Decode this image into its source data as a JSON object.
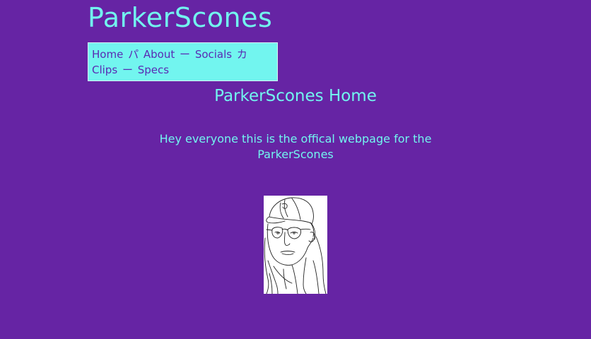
{
  "site": {
    "title": "ParkerScones"
  },
  "nav": {
    "items": [
      {
        "label": "Home",
        "sep": "パ"
      },
      {
        "label": "About",
        "sep": "ー"
      },
      {
        "label": "Socials",
        "sep": "カ"
      },
      {
        "label": "Clips",
        "sep": "ー"
      },
      {
        "label": "Specs",
        "sep": ""
      }
    ]
  },
  "main": {
    "heading": "ParkerScones Home",
    "intro": "Hey everyone this is the offical webpage for the ParkerScones",
    "image_alt": "line drawing portrait of person in cap and hoodie"
  },
  "colors": {
    "background": "#6624a4",
    "accent": "#72f5ef",
    "nav_text": "#5a2ab3"
  }
}
